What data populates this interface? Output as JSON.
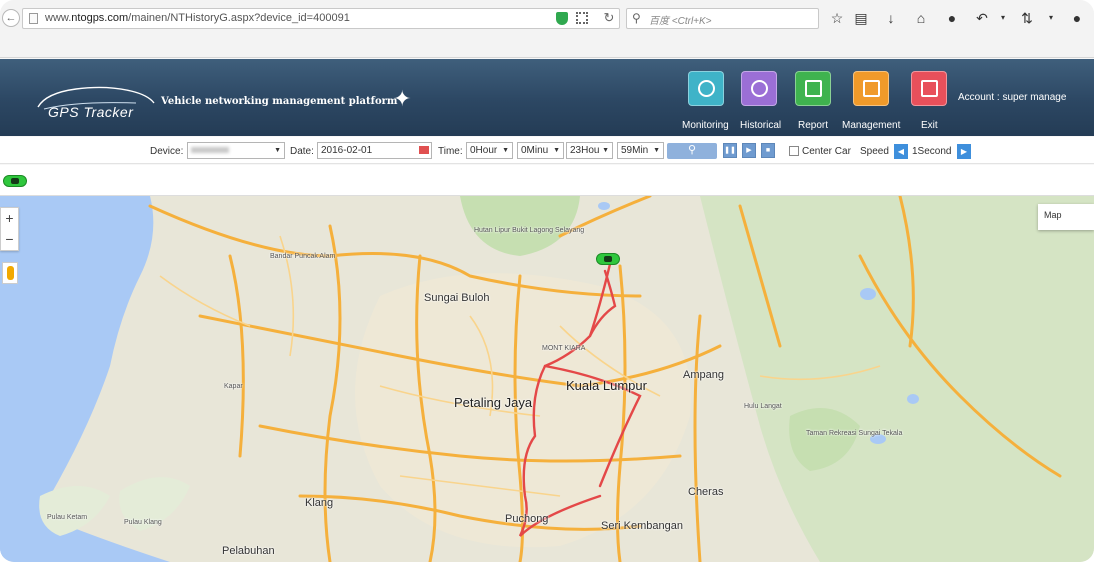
{
  "browser": {
    "url_prefix": "www.",
    "url_domain": "ntogps.com",
    "url_path": "/mainen/NTHistoryG.aspx?device_id=400091",
    "search_placeholder": "百度 <Ctrl+K>",
    "icons": [
      "back-icon",
      "page-icon",
      "shield-icon",
      "qr-icon",
      "reload-icon",
      "search-icon",
      "star-icon",
      "reading-list-icon",
      "download-icon",
      "home-icon",
      "chat-icon",
      "undo-icon",
      "sync-icon",
      "comment-icon"
    ]
  },
  "header": {
    "logo_text": "GPS Tracker",
    "platform_title": "Vehicle networking management platform",
    "nav": [
      {
        "label": "Monitoring",
        "color": "#3fb3c8"
      },
      {
        "label": "Historical",
        "color": "#9b6fd6"
      },
      {
        "label": "Report",
        "color": "#3fb34f"
      },
      {
        "label": "Management",
        "color": "#f09a2a"
      },
      {
        "label": "Exit",
        "color": "#e8505b"
      }
    ],
    "account": "Account : super manage"
  },
  "filter": {
    "device_label": "Device:",
    "date_label": "Date:",
    "date_value": "2016-02-01",
    "time_label": "Time:",
    "from_hour": "0Hour",
    "from_minute": "0Minu",
    "to_hour": "23Hou",
    "to_minute": "59Min",
    "center_car_label": "Center Car",
    "speed_label": "Speed",
    "speed_value": "1Second"
  },
  "map": {
    "zoom_in": "+",
    "zoom_out": "−",
    "map_type": "Map",
    "places": [
      {
        "name": "Bandar Puncak Alam",
        "cls": "small"
      },
      {
        "name": "Sungai Buloh",
        "cls": "med"
      },
      {
        "name": "Hutan Lipur Bukit Lagong",
        "cls": "small"
      },
      {
        "name": "Selayang",
        "cls": "small"
      },
      {
        "name": "MONT KIARA",
        "cls": "small"
      },
      {
        "name": "Kuala Lumpur",
        "cls": "big"
      },
      {
        "name": "Ampang",
        "cls": "med"
      },
      {
        "name": "Petaling Jaya",
        "cls": "big"
      },
      {
        "name": "Kapar",
        "cls": "small"
      },
      {
        "name": "Hulu Langat",
        "cls": "small"
      },
      {
        "name": "Taman Rekreasi Sungai Tekala",
        "cls": "small"
      },
      {
        "name": "Klang",
        "cls": "med"
      },
      {
        "name": "Cheras",
        "cls": "med"
      },
      {
        "name": "Puchong",
        "cls": "med"
      },
      {
        "name": "Seri Kembangan",
        "cls": "med"
      },
      {
        "name": "Pulau Ketam",
        "cls": "small"
      },
      {
        "name": "Pulau Klang",
        "cls": "small"
      },
      {
        "name": "Pelabuhan",
        "cls": "med"
      }
    ]
  }
}
